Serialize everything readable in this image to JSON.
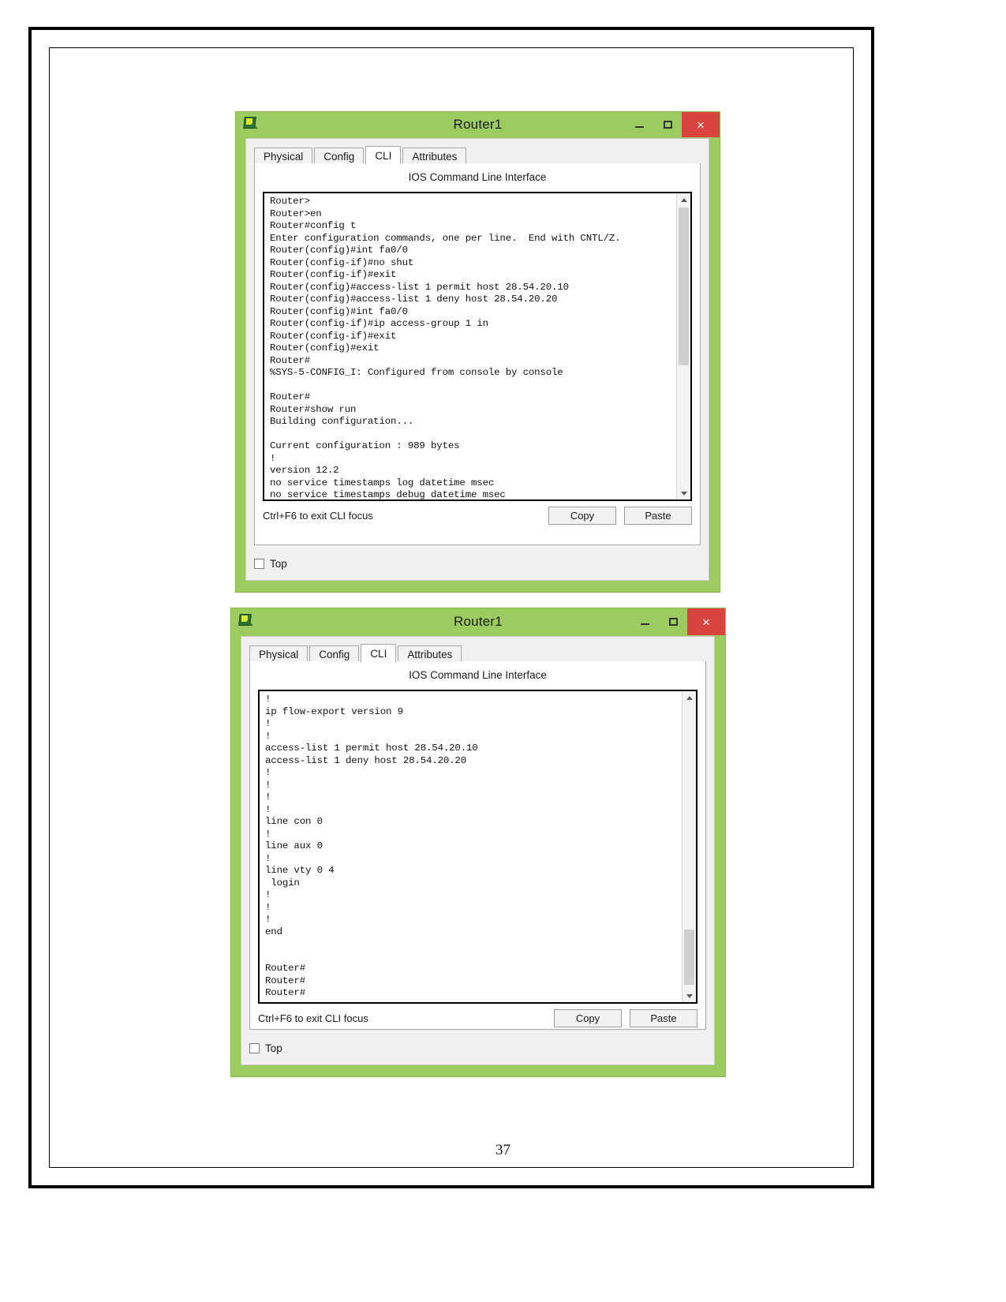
{
  "document": {
    "page_number": "37"
  },
  "windows": [
    {
      "title": "Router1",
      "icon": "packet-tracer-router-icon",
      "controls": {
        "minimize": "–",
        "maximize": "❐",
        "close": "×"
      },
      "tabs": [
        {
          "label": "Physical",
          "active": false
        },
        {
          "label": "Config",
          "active": false
        },
        {
          "label": "CLI",
          "active": true
        },
        {
          "label": "Attributes",
          "active": false
        }
      ],
      "panel_heading": "IOS Command Line Interface",
      "cli_text": "Router>\nRouter>en\nRouter#config t\nEnter configuration commands, one per line.  End with CNTL/Z.\nRouter(config)#int fa0/0\nRouter(config-if)#no shut\nRouter(config-if)#exit\nRouter(config)#access-list 1 permit host 28.54.20.10\nRouter(config)#access-list 1 deny host 28.54.20.20\nRouter(config)#int fa0/0\nRouter(config-if)#ip access-group 1 in\nRouter(config-if)#exit\nRouter(config)#exit\nRouter#\n%SYS-5-CONFIG_I: Configured from console by console\n\nRouter#\nRouter#show run\nBuilding configuration...\n\nCurrent configuration : 989 bytes\n!\nversion 12.2\nno service timestamps log datetime msec\nno service timestamps debug datetime msec",
      "hint": "Ctrl+F6 to exit CLI focus",
      "copy_label": "Copy",
      "paste_label": "Paste",
      "top_checkbox_label": "Top",
      "top_checkbox_checked": false
    },
    {
      "title": "Router1",
      "icon": "packet-tracer-router-icon",
      "controls": {
        "minimize": "–",
        "maximize": "❐",
        "close": "×"
      },
      "tabs": [
        {
          "label": "Physical",
          "active": false
        },
        {
          "label": "Config",
          "active": false
        },
        {
          "label": "CLI",
          "active": true
        },
        {
          "label": "Attributes",
          "active": false
        }
      ],
      "panel_heading": "IOS Command Line Interface",
      "cli_text": "!\nip flow-export version 9\n!\n!\naccess-list 1 permit host 28.54.20.10\naccess-list 1 deny host 28.54.20.20\n!\n!\n!\n!\nline con 0\n!\nline aux 0\n!\nline vty 0 4\n login\n!\n!\n!\nend\n\n\nRouter#\nRouter#\nRouter#",
      "hint": "Ctrl+F6 to exit CLI focus",
      "copy_label": "Copy",
      "paste_label": "Paste",
      "top_checkbox_label": "Top",
      "top_checkbox_checked": false
    }
  ],
  "colors": {
    "window_chrome": "#9ccb5f",
    "close_button": "#d9443f",
    "panel_background": "#f0f0f0"
  }
}
